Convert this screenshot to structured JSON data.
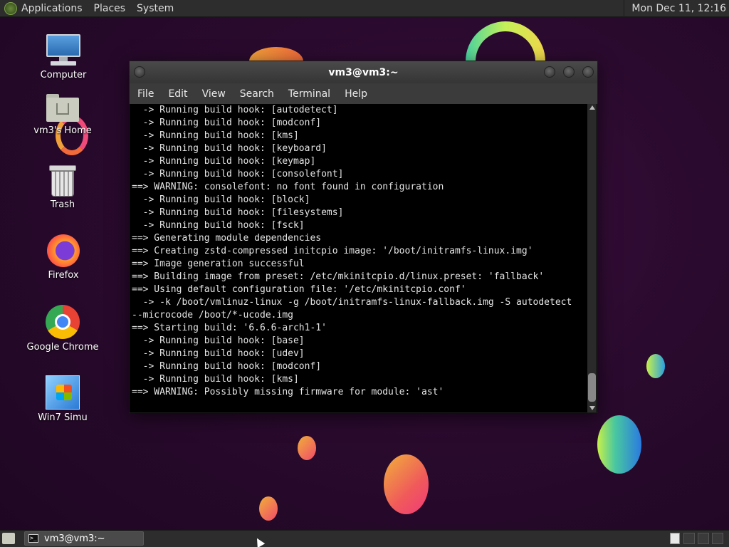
{
  "top_panel": {
    "menu": [
      "Applications",
      "Places",
      "System"
    ],
    "clock": "Mon Dec 11, 12:16"
  },
  "desktop_icons": [
    {
      "label": "Computer",
      "icon": "computer-icon"
    },
    {
      "label": "vm3's Home",
      "icon": "home-folder-icon"
    },
    {
      "label": "Trash",
      "icon": "trash-icon"
    },
    {
      "label": "Firefox",
      "icon": "firefox-icon"
    },
    {
      "label": "Google Chrome",
      "icon": "chrome-icon"
    },
    {
      "label": "Win7 Simu",
      "icon": "win7-icon"
    }
  ],
  "terminal": {
    "title": "vm3@vm3:~",
    "menu": [
      "File",
      "Edit",
      "View",
      "Search",
      "Terminal",
      "Help"
    ],
    "lines": [
      "  -> Running build hook: [autodetect]",
      "  -> Running build hook: [modconf]",
      "  -> Running build hook: [kms]",
      "  -> Running build hook: [keyboard]",
      "  -> Running build hook: [keymap]",
      "  -> Running build hook: [consolefont]",
      "==> WARNING: consolefont: no font found in configuration",
      "  -> Running build hook: [block]",
      "  -> Running build hook: [filesystems]",
      "  -> Running build hook: [fsck]",
      "==> Generating module dependencies",
      "==> Creating zstd-compressed initcpio image: '/boot/initramfs-linux.img'",
      "==> Image generation successful",
      "==> Building image from preset: /etc/mkinitcpio.d/linux.preset: 'fallback'",
      "==> Using default configuration file: '/etc/mkinitcpio.conf'",
      "  -> -k /boot/vmlinuz-linux -g /boot/initramfs-linux-fallback.img -S autodetect",
      "--microcode /boot/*-ucode.img",
      "==> Starting build: '6.6.6-arch1-1'",
      "  -> Running build hook: [base]",
      "  -> Running build hook: [udev]",
      "  -> Running build hook: [modconf]",
      "  -> Running build hook: [kms]",
      "==> WARNING: Possibly missing firmware for module: 'ast'"
    ]
  },
  "taskbar": {
    "task_label": "vm3@vm3:~",
    "task_icon": "terminal-icon"
  },
  "colors": {
    "panel": "#2d2d2d",
    "desktop": "#2a0a2e",
    "terminal_bg": "#000000",
    "terminal_fg": "#e4e4e4"
  }
}
